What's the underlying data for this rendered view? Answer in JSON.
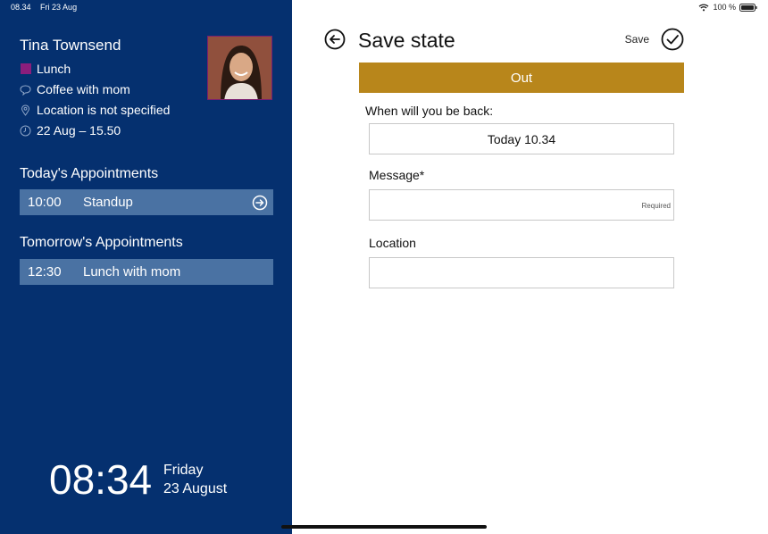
{
  "status_bar": {
    "time": "08.34",
    "date": "Fri 23 Aug",
    "battery": "100 %"
  },
  "profile": {
    "name": "Tina Townsend",
    "status": "Lunch",
    "status_color": "#8b1e7c",
    "message": "Coffee with mom",
    "location": "Location is not specified",
    "until": "22 Aug – 15.50"
  },
  "today": {
    "title": "Today's Appointments",
    "items": [
      {
        "time": "10:00",
        "title": "Standup"
      }
    ]
  },
  "tomorrow": {
    "title": "Tomorrow's Appointments",
    "items": [
      {
        "time": "12:30",
        "title": "Lunch with mom"
      }
    ]
  },
  "clock": {
    "time": "08:34",
    "weekday": "Friday",
    "date": "23 August"
  },
  "form": {
    "title": "Save state",
    "save_label": "Save",
    "state_banner": "Out",
    "banner_color": "#b8861b",
    "back_label": "When will you be back:",
    "back_value": "Today  10.34",
    "message_label": "Message*",
    "message_value": "",
    "message_hint": "Required",
    "location_label": "Location",
    "location_value": ""
  },
  "colors": {
    "sidebar_bg": "#05306f",
    "appt_bg": "#4a72a3"
  }
}
